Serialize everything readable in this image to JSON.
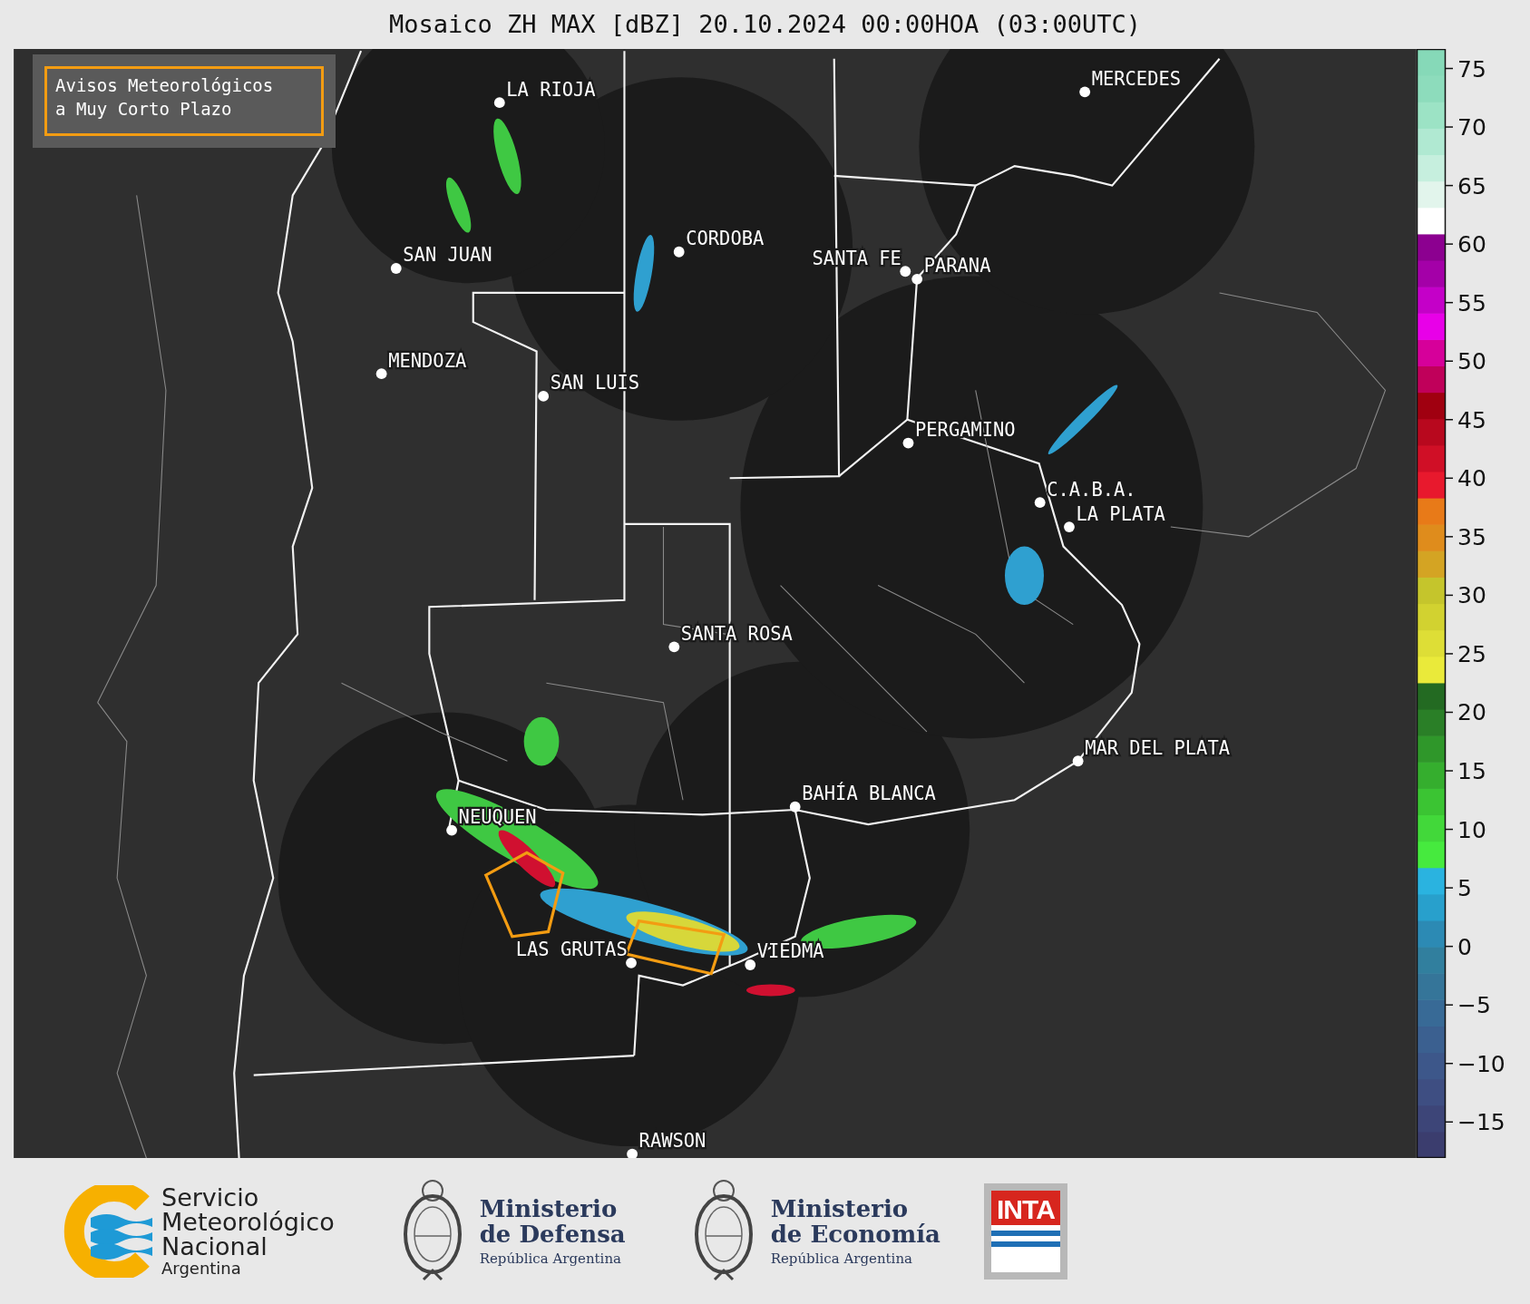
{
  "title": "Mosaico ZH MAX [dBZ] 20.10.2024 00:00HOA (03:00UTC)",
  "legend": {
    "lines": [
      "Avisos Meteorológicos",
      "a Muy Corto Plazo"
    ]
  },
  "cities": [
    {
      "name": "LA RIOJA"
    },
    {
      "name": "MERCEDES"
    },
    {
      "name": "CORDOBA"
    },
    {
      "name": "SAN JUAN"
    },
    {
      "name": "SANTA FE"
    },
    {
      "name": "PARANA"
    },
    {
      "name": "MENDOZA"
    },
    {
      "name": "SAN LUIS"
    },
    {
      "name": "PERGAMINO"
    },
    {
      "name": "C.A.B.A."
    },
    {
      "name": "LA PLATA"
    },
    {
      "name": "SANTA ROSA"
    },
    {
      "name": "MAR DEL PLATA"
    },
    {
      "name": "BAHÍA BLANCA"
    },
    {
      "name": "NEUQUEN"
    },
    {
      "name": "LAS GRUTAS"
    },
    {
      "name": "VIEDMA"
    },
    {
      "name": "RAWSON"
    }
  ],
  "colorbar": {
    "ticks": [
      "75",
      "70",
      "65",
      "60",
      "55",
      "50",
      "45",
      "40",
      "35",
      "30",
      "25",
      "20",
      "15",
      "10",
      "5",
      "0",
      "−5",
      "−10",
      "−15"
    ]
  },
  "logos": {
    "smn": [
      "Servicio",
      "Meteorológico",
      "Nacional",
      "Argentina"
    ],
    "defensa": [
      "Ministerio",
      "de Defensa",
      "República Argentina"
    ],
    "economia": [
      "Ministerio",
      "de Economía",
      "República Argentina"
    ],
    "inta": "INTA"
  }
}
